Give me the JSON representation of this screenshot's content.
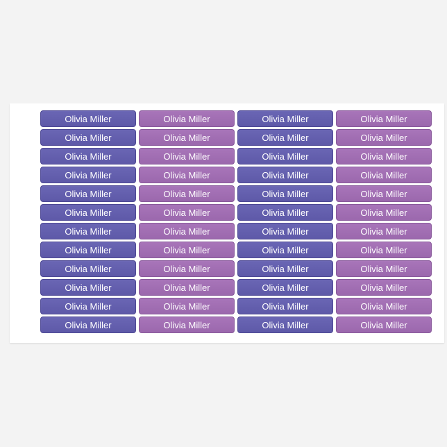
{
  "label_text": "Olivia Miller",
  "rows": 12,
  "columns": [
    {
      "style": "purple"
    },
    {
      "style": "pink"
    },
    {
      "style": "purple"
    },
    {
      "style": "pink"
    }
  ],
  "colors": {
    "purple": "#625eac",
    "pink": "#a16db3",
    "text": "#ffffff",
    "sheet": "#ffffff",
    "background": "#f3f3f3"
  }
}
